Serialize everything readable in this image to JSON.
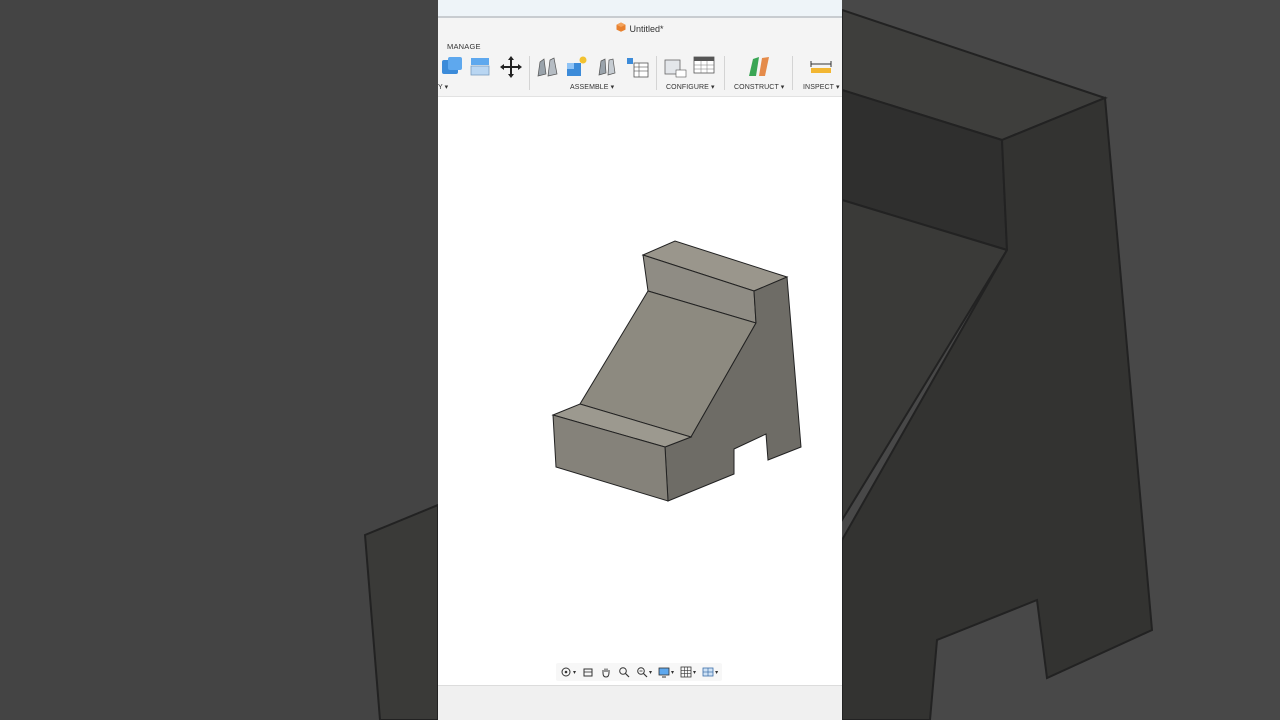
{
  "document": {
    "title": "Untitled*"
  },
  "ribbon": {
    "tab": "MANAGE",
    "groups": [
      {
        "label": "Y ▾"
      },
      {
        "label": "ASSEMBLE ▾"
      },
      {
        "label": "CONFIGURE ▾"
      },
      {
        "label": "CONSTRUCT ▾"
      },
      {
        "label": "INSPECT ▾"
      }
    ],
    "tools": [
      "combine-icon",
      "align-icon",
      "move-icon",
      "joint-icon",
      "new-component-icon",
      "as-built-joint-icon",
      "bom-table-icon",
      "configure-icon",
      "configuration-table-icon",
      "offset-plane-icon",
      "measure-icon"
    ]
  },
  "viewport": {
    "model": "angled-bracket-block",
    "model_color": "#8a8880"
  },
  "navbar": {
    "buttons": [
      "orbit-icon",
      "look-at-icon",
      "pan-icon",
      "zoom-window-icon",
      "zoom-icon",
      "display-settings-icon",
      "grid-icon",
      "viewports-icon"
    ]
  },
  "colors": {
    "accent": "#3c8bd9",
    "doc_icon": "#e8812f",
    "background": "#3c3c3c"
  }
}
